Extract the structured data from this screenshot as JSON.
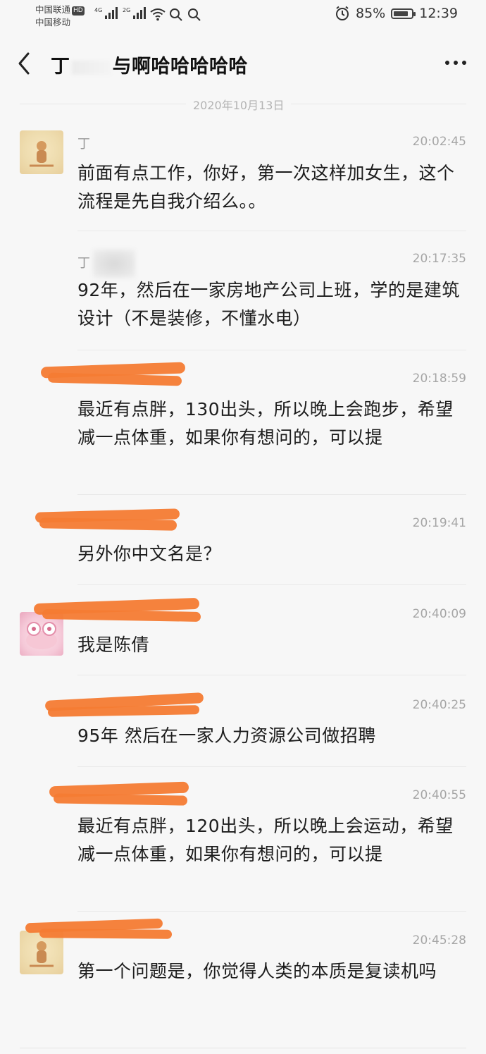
{
  "status_bar": {
    "carrier1": "中国联通",
    "carrier1_badge": "HD",
    "carrier2": "中国移动",
    "net1": "4G",
    "net2": "2G",
    "battery_percent": 85,
    "battery_text": "85%",
    "clock": "12:39"
  },
  "header": {
    "title_prefix": "丁",
    "title_suffix": "与啊哈哈哈哈哈"
  },
  "date_divider": "2020年10月13日",
  "messages": [
    {
      "sender": "丁",
      "time": "20:02:45",
      "text": "前面有点工作，你好，第一次这样加女生，这个流程是先自我介绍么。。"
    },
    {
      "sender": "丁",
      "time": "20:17:35",
      "text": "92年，然后在一家房地产公司上班，学的是建筑设计（不是装修，不懂水电）"
    },
    {
      "sender": "",
      "time": "20:18:59",
      "text": "最近有点胖，130出头，所以晚上会跑步，希望减一点体重，如果你有想问的，可以提"
    },
    {
      "sender": "",
      "time": "20:19:41",
      "text": "另外你中文名是？"
    },
    {
      "sender": "",
      "time": "20:40:09",
      "text": "我是陈倩"
    },
    {
      "sender": "",
      "time": "20:40:25",
      "text": "95年 然后在一家人力资源公司做招聘"
    },
    {
      "sender": "",
      "time": "20:40:55",
      "text": "最近有点胖，120出头，所以晚上会运动，希望减一点体重，如果你有想问的，可以提"
    },
    {
      "sender": "",
      "time": "20:45:28",
      "text": "第一个问题是，你觉得人类的本质是复读机吗"
    }
  ],
  "colors": {
    "background": "#f7f7f7",
    "redaction": "#f47b33",
    "timestamp": "#a6a6a6"
  }
}
